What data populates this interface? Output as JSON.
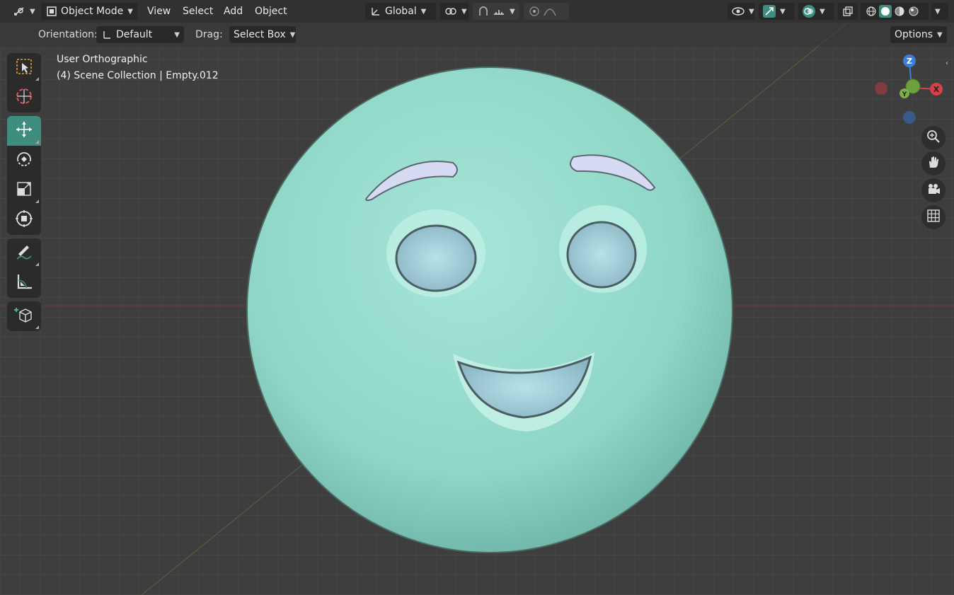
{
  "header": {
    "editor_type_icon": "editor-type-icon",
    "mode": "Object Mode",
    "menus": [
      "View",
      "Select",
      "Add",
      "Object"
    ],
    "transform_orientation": "Global",
    "icons": {
      "snap": "snap-icon",
      "proportional": "proportional-editing-icon",
      "visibility": "visibility-icon",
      "gizmo": "gizmo-icon",
      "overlay": "overlay-icon",
      "xray": "xray-icon",
      "shading_wire": "wireframe-shading-icon",
      "shading_solid": "solid-shading-icon",
      "shading_material": "material-shading-icon",
      "shading_rendered": "rendered-shading-icon"
    }
  },
  "tool_settings": {
    "orientation_label": "Orientation:",
    "orientation_value": "Default",
    "drag_label": "Drag:",
    "drag_value": "Select Box",
    "options_label": "Options"
  },
  "viewport": {
    "view_name": "User Orthographic",
    "collection_info": "(4) Scene Collection | Empty.012"
  },
  "toolbar": {
    "tools": [
      "select-box",
      "cursor",
      "move",
      "rotate",
      "scale",
      "transform",
      "annotate",
      "measure",
      "add-cube"
    ],
    "active_tool": "move"
  },
  "gizmo": {
    "z_label": "Z",
    "x_label": "X",
    "y_label": "Y"
  },
  "colors": {
    "accent_active": "#3f8d7f",
    "header_bg": "#303030",
    "model": "#8fd6c7"
  }
}
